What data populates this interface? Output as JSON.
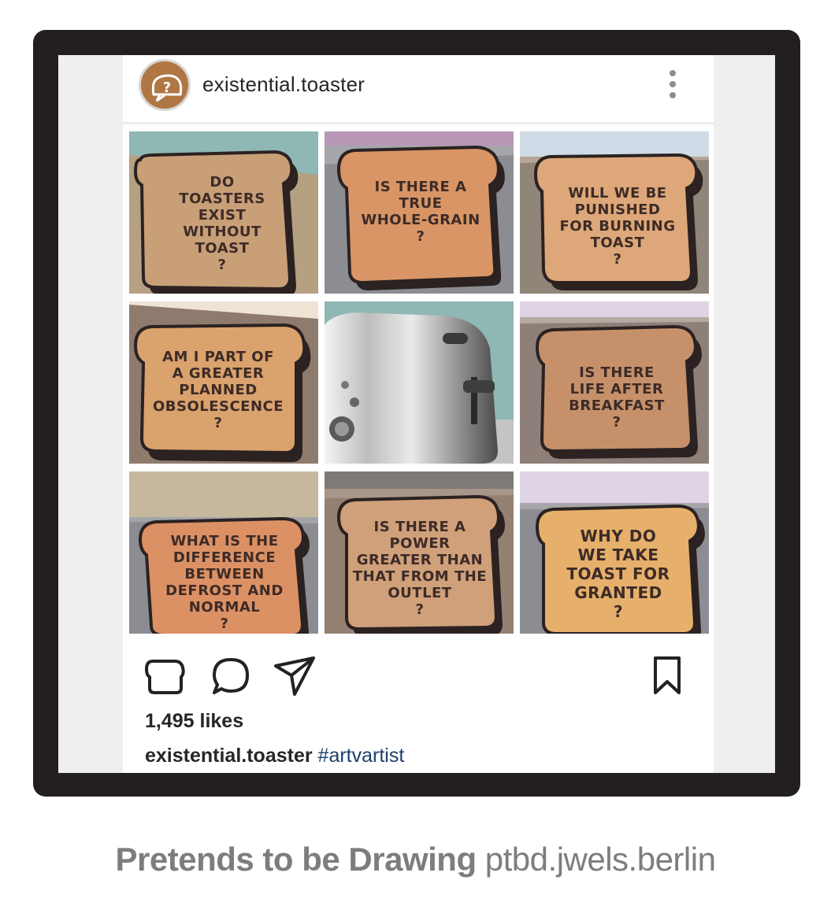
{
  "post": {
    "username": "existential.toaster",
    "likes": "1,495 likes",
    "caption_user": "existential.toaster",
    "caption_hashtag": "#artvartist"
  },
  "tiles": [
    {
      "text": "DO\nTOASTERS\nEXIST\nWITHOUT\nTOAST\n?"
    },
    {
      "text": "IS THERE A\nTRUE\nWHOLE-GRAIN\n?"
    },
    {
      "text": "WILL WE BE\nPUNISHED\nFOR BURNING\nTOAST\n?"
    },
    {
      "text": "AM I PART OF\nA GREATER\nPLANNED\nOBSOLESCENCE\n?"
    },
    {
      "text": ""
    },
    {
      "text": "IS THERE\nLIFE AFTER\nBREAKFAST\n?"
    },
    {
      "text": "WHAT IS THE\nDIFFERENCE\nBETWEEN\nDEFROST AND\nNORMAL\n?"
    },
    {
      "text": "IS THERE A\nPOWER\nGREATER THAN\nTHAT FROM THE\nOUTLET\n?"
    },
    {
      "text": "WHY DO\nWE TAKE\nTOAST FOR\nGRANTED\n?"
    }
  ],
  "icons": {
    "avatar": "toaster-question-icon",
    "more": "more-options-icon",
    "like": "toast-like-icon",
    "comment": "comment-icon",
    "share": "send-icon",
    "save": "bookmark-icon"
  },
  "footer": {
    "brand": "Pretends to be Drawing",
    "url": "ptbd.jwels.berlin"
  }
}
